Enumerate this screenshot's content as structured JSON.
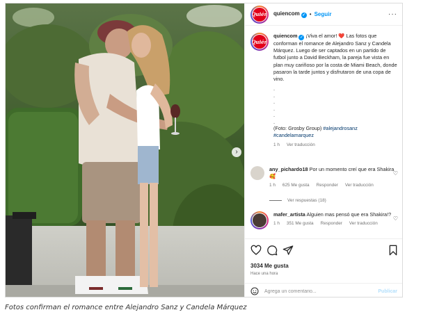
{
  "post": {
    "username": "quiencom",
    "separator": "•",
    "follow_label": "Seguir",
    "more_label": "···",
    "avatar_logo": "Quién"
  },
  "caption_entry": {
    "username": "quiencom",
    "text": "¡Viva el amor! ❤️ Las fotos que conforman el romance de Alejandro Sanz y Candela Márquez. Luego de ser captados en un partido de futbol junto a David Beckham, la pareja fue vista en plan muy cariñoso por la costa de Miami Beach, donde pasaron la tarde juntos y disfrutaron de una copa de vino.",
    "dots": [
      ".",
      ".",
      ".",
      ".",
      ".",
      "."
    ],
    "credit": "(Foto: Grosby Group)",
    "hashtag1": "#alejandrosanz",
    "hashtag2": "#candelamarquez",
    "time": "1 h",
    "translate": "Ver traducción"
  },
  "comments": [
    {
      "username": "any_pichardo18",
      "text": "Por un momento creí que era Shakira 🥰",
      "time": "1 h",
      "likes": "625 Me gusta",
      "reply": "Responder",
      "translate": "Ver traducción",
      "replies": "Ver respuestas (18)"
    },
    {
      "username": "mafer_artista",
      "text": "Alguien mas pensó que era Shakira!?",
      "time": "1 h",
      "likes": "351 Me gusta",
      "reply": "Responder",
      "translate": "Ver traducción"
    }
  ],
  "actions": {
    "likes": "3034 Me gusta",
    "time_ago": "Hace una hora",
    "comment_placeholder": "Agrega un comentario...",
    "publish_label": "Publicar"
  },
  "page_caption": "Fotos confirman el romance entre Alejandro Sanz y Candela Márquez",
  "colors": {
    "link": "#0095f6",
    "hashtag": "#00376b",
    "brand": "#e2001a",
    "heart": "#ed4956"
  },
  "icons": [
    "heart-icon",
    "comment-icon",
    "share-icon",
    "bookmark-icon",
    "emoji-icon",
    "verified-icon",
    "more-options-icon",
    "chevron-right-icon"
  ]
}
